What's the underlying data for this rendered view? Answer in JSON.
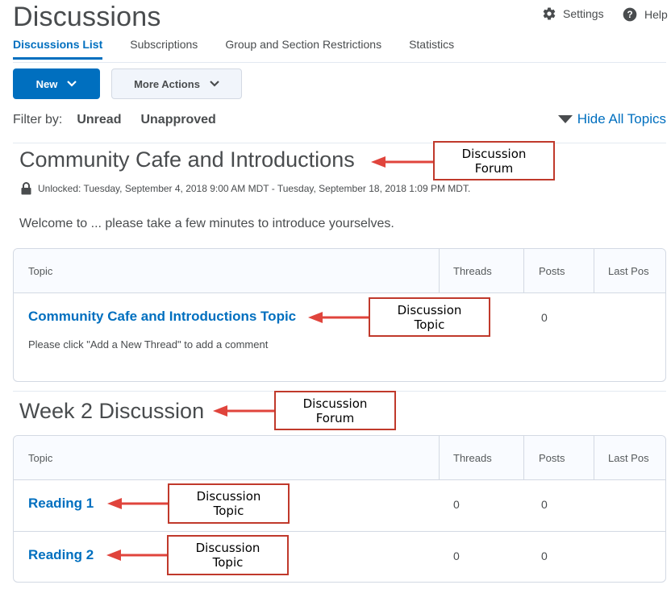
{
  "header": {
    "title": "Discussions",
    "settings_label": "Settings",
    "help_label": "Help",
    "tabs": [
      {
        "label": "Discussions List",
        "active": true
      },
      {
        "label": "Subscriptions",
        "active": false
      },
      {
        "label": "Group and Section Restrictions",
        "active": false
      },
      {
        "label": "Statistics",
        "active": false
      }
    ]
  },
  "toolbar": {
    "new_label": "New",
    "more_actions_label": "More Actions"
  },
  "filter": {
    "label": "Filter by:",
    "unread": "Unread",
    "unapproved": "Unapproved",
    "hide_all_topics": "Hide All Topics"
  },
  "forums": [
    {
      "title": "Community Cafe and Introductions",
      "unlock_text": "Unlocked: Tuesday, September 4, 2018 9:00 AM MDT - Tuesday, September 18, 2018 1:09 PM MDT.",
      "description": "Welcome to ... please take a few minutes to introduce yourselves.",
      "columns": [
        "Topic",
        "Threads",
        "Posts",
        "Last Pos"
      ],
      "topics": [
        {
          "name": "Community Cafe and Introductions Topic",
          "description": "Please click \"Add a New Thread\" to add a comment",
          "threads": "",
          "posts": "0"
        }
      ]
    },
    {
      "title": "Week 2 Discussion",
      "columns": [
        "Topic",
        "Threads",
        "Posts",
        "Last Pos"
      ],
      "topics": [
        {
          "name": "Reading 1",
          "threads": "0",
          "posts": "0"
        },
        {
          "name": "Reading 2",
          "threads": "0",
          "posts": "0"
        }
      ]
    }
  ],
  "annotations": {
    "forum_1": "Discussion",
    "forum_2": "Forum",
    "topic_1": "Discussion",
    "topic_2": "Topic"
  },
  "colors": {
    "accent": "#006fbf",
    "callout_border": "#c0392b",
    "arrow": "#e0443c"
  }
}
